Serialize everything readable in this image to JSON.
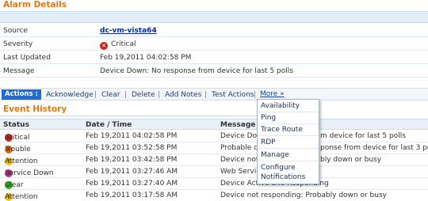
{
  "alarm_details": {
    "title": "Alarm Details",
    "rows": [
      {
        "label": "Source",
        "value": "dc-vm-vista64",
        "icon": "",
        "is_link": true
      },
      {
        "label": "Severity",
        "value": "Critical",
        "icon": "critical-icon",
        "is_link": false
      },
      {
        "label": "Last Updated",
        "value": "Feb 19,2011 04:02:58 PM",
        "icon": "",
        "is_link": false
      },
      {
        "label": "Message",
        "value": "Device Down: No response from device for last 5 polls",
        "icon": "",
        "is_link": false
      }
    ]
  },
  "actions": {
    "label": "Actions :",
    "items": [
      "Acknowledge",
      "Clear",
      "Delete",
      "Add Notes",
      "Test Actions"
    ],
    "separator": "|",
    "more_label": "More »"
  },
  "more_menu": {
    "items": [
      "Availability",
      "Ping",
      "Trace Route",
      "RDP",
      "Manage",
      "Configure",
      "Notifications"
    ]
  },
  "event_history": {
    "title": "Event History",
    "columns": [
      "Status",
      "Date / Time",
      "Message"
    ],
    "rows": [
      {
        "status": "Critical",
        "icon": "critical-icon",
        "date": "Feb 19,2011 04:02:58 PM",
        "message": "Device Dow",
        "tail": "m device for last 5 polls"
      },
      {
        "status": "Trouble",
        "icon": "trouble-icon",
        "date": "Feb 19,2011 03:52:58 PM",
        "message": "Probable de",
        "tail": "ponse from device for last 3 polls"
      },
      {
        "status": "Attention",
        "icon": "attention-icon",
        "date": "Feb 19,2011 03:42:58 PM",
        "message": "Device not",
        "tail": "bly down or busy"
      },
      {
        "status": "Service Down",
        "icon": "service-down-icon",
        "date": "Feb 19,2011 03:27:46 AM",
        "message": "Web Servic",
        "tail": ""
      },
      {
        "status": "Clear",
        "icon": "clear-icon",
        "date": "Feb 19,2011 03:27:40 AM",
        "message": "Device Active and Responding",
        "tail": ""
      },
      {
        "status": "Attention",
        "icon": "attention-icon",
        "date": "Feb 19,2011 03:17:58 AM",
        "message": "Device not responding: Probably down or busy",
        "tail": ""
      }
    ]
  },
  "colors": {
    "section_title": "#e8760a",
    "actions_button": "#1f6bd8",
    "critical": "#c8261b",
    "trouble": "#e36b10",
    "attention": "#f1c40f",
    "service_down": "#c22a9a",
    "clear": "#3aa428"
  }
}
